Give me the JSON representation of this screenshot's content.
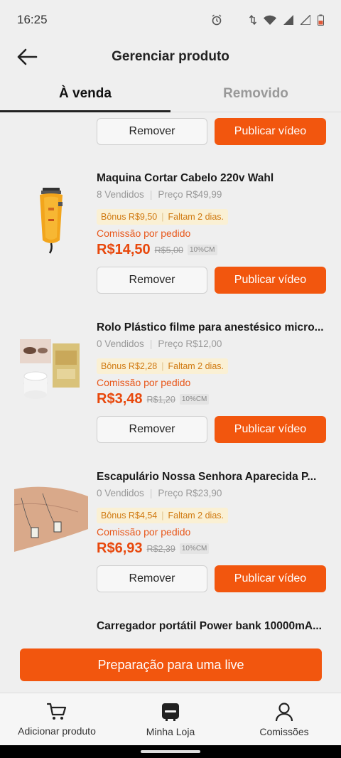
{
  "status": {
    "time": "16:25"
  },
  "header": {
    "title": "Gerenciar produto"
  },
  "tabs": [
    {
      "label": "À venda",
      "active": true
    },
    {
      "label": "Removido",
      "active": false
    }
  ],
  "buttons": {
    "remove": "Remover",
    "publish": "Publicar vídeo"
  },
  "products": [
    {
      "title": "Maquina Cortar Cabelo 220v Wahl",
      "sold": "8 Vendidos",
      "price": "Preço R$49,99",
      "bonus": "Bônus R$9,50",
      "remaining": "Faltam 2 dias.",
      "commission_label": "Comissão por pedido",
      "commission": "R$14,50",
      "old_commission": "R$5,00",
      "badge": "10%CM"
    },
    {
      "title": "Rolo Plástico filme para anestésico micro...",
      "sold": "0 Vendidos",
      "price": "Preço R$12,00",
      "bonus": "Bônus R$2,28",
      "remaining": "Faltam 2 dias.",
      "commission_label": "Comissão por pedido",
      "commission": "R$3,48",
      "old_commission": "R$1,20",
      "badge": "10%CM"
    },
    {
      "title": "Escapulário Nossa Senhora Aparecida P...",
      "sold": "0 Vendidos",
      "price": "Preço R$23,90",
      "bonus": "Bônus R$4,54",
      "remaining": "Faltam 2 dias.",
      "commission_label": "Comissão por pedido",
      "commission": "R$6,93",
      "old_commission": "R$2,39",
      "badge": "10%CM"
    },
    {
      "title": "Carregador portátil Power bank 10000mA..."
    }
  ],
  "cta": {
    "label": "Preparação para uma live"
  },
  "bottom_nav": [
    {
      "label": "Adicionar produto",
      "icon": "cart-icon"
    },
    {
      "label": "Minha Loja",
      "icon": "store-icon"
    },
    {
      "label": "Comissões",
      "icon": "person-icon"
    }
  ],
  "colors": {
    "accent": "#f2560e",
    "price": "#e8480c",
    "bonus_bg": "#faf0d4"
  }
}
